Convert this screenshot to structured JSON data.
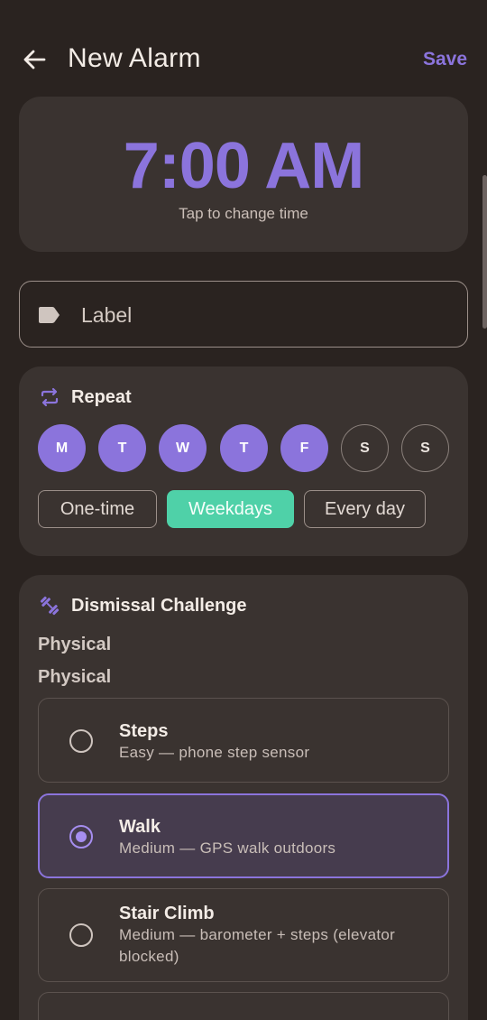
{
  "header": {
    "title": "New Alarm",
    "save_label": "Save"
  },
  "time": {
    "value": "7:00 AM",
    "hint": "Tap to change time"
  },
  "label_field": {
    "placeholder": "Label"
  },
  "repeat": {
    "heading": "Repeat",
    "days": [
      {
        "label": "M",
        "selected": true
      },
      {
        "label": "T",
        "selected": true
      },
      {
        "label": "W",
        "selected": true
      },
      {
        "label": "T",
        "selected": true
      },
      {
        "label": "F",
        "selected": true
      },
      {
        "label": "S",
        "selected": false
      },
      {
        "label": "S",
        "selected": false
      }
    ],
    "presets": [
      {
        "label": "One-time",
        "selected": false
      },
      {
        "label": "Weekdays",
        "selected": true
      },
      {
        "label": "Every day",
        "selected": false
      }
    ]
  },
  "challenge": {
    "heading": "Dismissal Challenge",
    "category_dropdown": "Physical",
    "category_label": "Physical",
    "options": [
      {
        "title": "Steps",
        "subtitle": "Easy — phone step sensor",
        "selected": false
      },
      {
        "title": "Walk",
        "subtitle": "Medium — GPS walk outdoors",
        "selected": true
      },
      {
        "title": "Stair Climb",
        "subtitle": "Medium — barometer + steps (elevator blocked)",
        "selected": false
      },
      {
        "title": "",
        "subtitle": "",
        "selected": false
      }
    ]
  },
  "colors": {
    "background": "#2a2320",
    "card": "#3a3330",
    "accent": "#8b74dc",
    "chip_selected": "#4fd1a8"
  },
  "icons": {
    "back": "arrow-left-icon",
    "label": "tag-icon",
    "repeat": "repeat-icon",
    "challenge": "dumbbell-icon"
  }
}
